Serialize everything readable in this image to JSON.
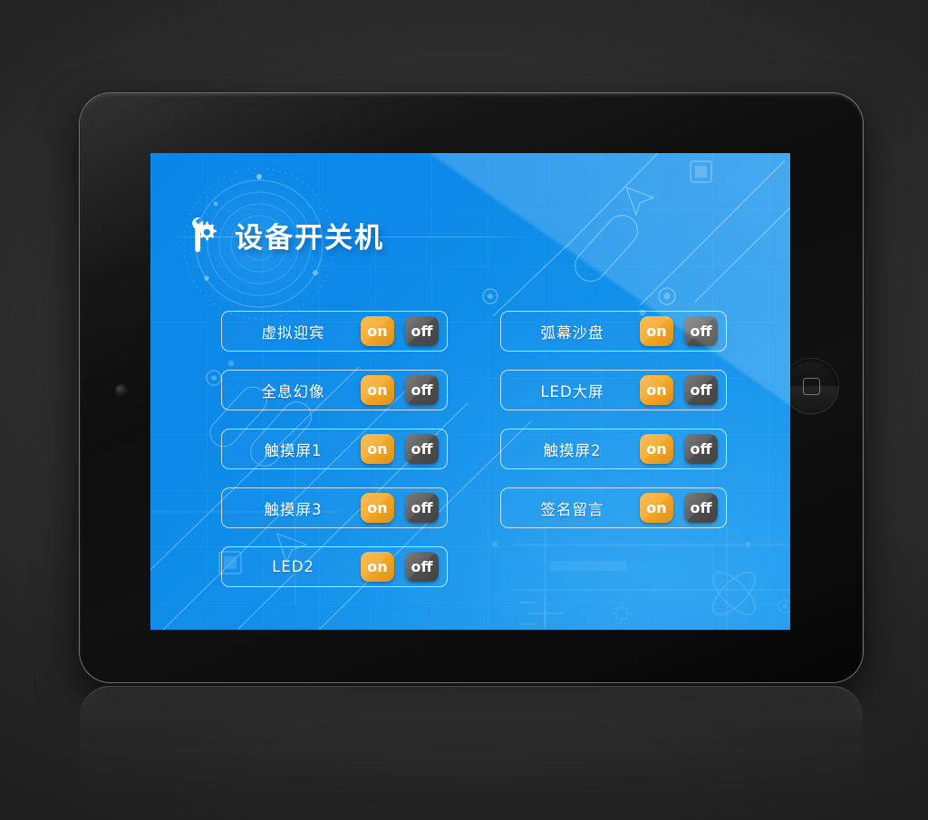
{
  "app": {
    "title": "设备开关机",
    "title_icon": "wrench-gear-icon"
  },
  "device": {
    "frame": "tablet-device",
    "home_button_icon": "home-square-icon",
    "camera_icon": "camera-lens-icon"
  },
  "colors": {
    "screen_blue": "#0d8ae9",
    "on_orange": "#f5a623",
    "off_gray": "#4d4d4d",
    "row_border": "#ffffff",
    "bezel_black": "#0d0d0d"
  },
  "buttons": {
    "on_label": "on",
    "off_label": "off"
  },
  "panel": {
    "columns": [
      {
        "rows": [
          {
            "label": "虚拟迎宾"
          },
          {
            "label": "全息幻像"
          },
          {
            "label": "触摸屏1"
          },
          {
            "label": "触摸屏3"
          },
          {
            "label": "LED2"
          }
        ]
      },
      {
        "rows": [
          {
            "label": "弧幕沙盘"
          },
          {
            "label": "LED大屏"
          },
          {
            "label": "触摸屏2"
          },
          {
            "label": "签名留言"
          }
        ]
      }
    ]
  },
  "decorations": {
    "radar_rings": "concentric-radar-circles",
    "circuit_lines": "diagonal-circuit-lines",
    "atom_symbol": "atom-orbit-icon",
    "crosshair": "crosshair-icon",
    "arrow_cursor": "arrow-cursor-icon",
    "squares": "square-node-icon"
  }
}
